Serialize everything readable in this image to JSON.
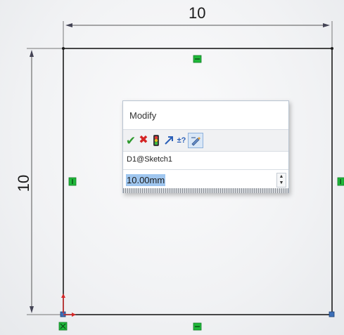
{
  "sketch": {
    "horizontal_dimension": "10",
    "vertical_dimension": "10"
  },
  "modify_dialog": {
    "title": "Modify",
    "toolbar": {
      "ok_icon": "checkmark-icon",
      "cancel_icon": "x-icon",
      "rebuild_icon": "traffic-light-icon",
      "reverse_icon": "reverse-direction-icon",
      "mark_dimension_icon": "plus-minus-question-icon",
      "driven_icon": "dimension-pencil-icon"
    },
    "dimension_name": "D1@Sketch1",
    "value": "10.00mm"
  },
  "colors": {
    "sketch_line": "#1c1c1c",
    "relation_marker": "#1fb83a",
    "selected_text": "#9fc6ef"
  }
}
